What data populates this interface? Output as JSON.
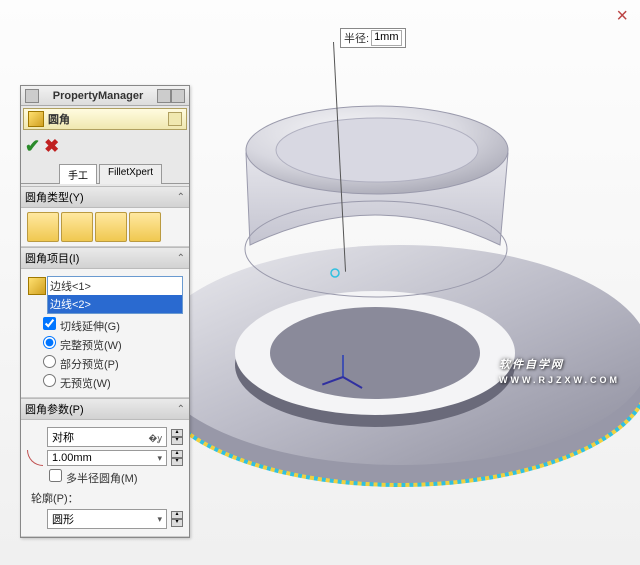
{
  "close_icon": "×",
  "callout": {
    "label": "半径:",
    "value": "1mm"
  },
  "panel": {
    "pm_title": "PropertyManager",
    "feature_title": "圆角",
    "ok_glyph": "✔",
    "cancel_glyph": "✖",
    "tabs": {
      "manual": "手工",
      "xpert": "FilletXpert"
    },
    "sections": {
      "type": {
        "title": "圆角类型(Y)"
      },
      "items": {
        "title": "圆角项目(I)",
        "edges": [
          "边线<1>",
          "边线<2>"
        ],
        "tangent": "切线延伸(G)",
        "full_preview": "完整预览(W)",
        "partial_preview": "部分预览(P)",
        "no_preview": "无预览(W)"
      },
      "params": {
        "title": "圆角参数(P)",
        "symmetry": "对称",
        "radius": "1.00mm",
        "multi_radius": "多半径圆角(M)",
        "profile_label": "轮廓(P)：",
        "profile_value": "圆形"
      }
    }
  },
  "watermark": {
    "main": "软件自学网",
    "sub": "WWW.RJZXW.COM"
  }
}
